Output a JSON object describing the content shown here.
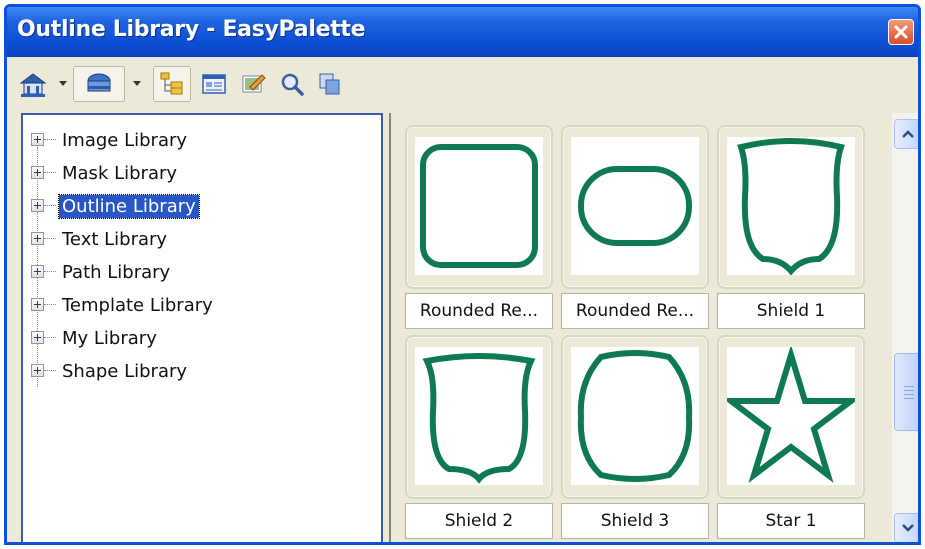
{
  "window": {
    "title": "Outline Library - EasyPalette"
  },
  "toolbar": {
    "icons": [
      "home-icon",
      "library-icon",
      "tree-view-icon",
      "details-view-icon",
      "edit-icon",
      "search-icon",
      "copy-icon"
    ]
  },
  "tree": {
    "items": [
      {
        "label": "Image Library",
        "selected": false
      },
      {
        "label": "Mask Library",
        "selected": false
      },
      {
        "label": "Outline Library",
        "selected": true
      },
      {
        "label": "Text Library",
        "selected": false
      },
      {
        "label": "Path Library",
        "selected": false
      },
      {
        "label": "Template Library",
        "selected": false
      },
      {
        "label": "My Library",
        "selected": false
      },
      {
        "label": "Shape Library",
        "selected": false
      }
    ]
  },
  "gallery": {
    "items": [
      {
        "label": "Rounded Re...",
        "shape": "rounded-square"
      },
      {
        "label": "Rounded Re...",
        "shape": "rounded-rectangle"
      },
      {
        "label": "Shield 1",
        "shape": "shield-1"
      },
      {
        "label": "Shield 2",
        "shape": "shield-2"
      },
      {
        "label": "Shield 3",
        "shape": "shield-3"
      },
      {
        "label": "Star 1",
        "shape": "star"
      }
    ],
    "outline_color": "#0f7a52"
  },
  "scrollbar": {
    "position": 0.6
  },
  "colors": {
    "titlebar": "#0d4fd3",
    "selection": "#2757c6",
    "close": "#d94d2b"
  }
}
